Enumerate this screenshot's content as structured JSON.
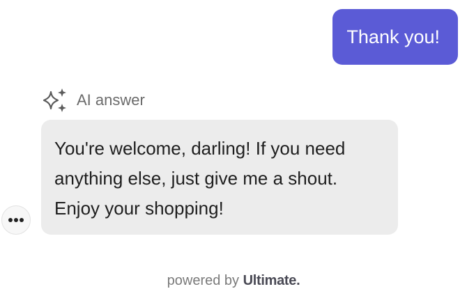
{
  "chat": {
    "user_message": "Thank you!",
    "ai_label": "AI answer",
    "ai_message": "You're welcome, darling! If you need anything else, just give me a shout. Enjoy your shopping!",
    "more_icon": "more-horizontal-icon",
    "ai_icon": "sparkles-icon"
  },
  "footer": {
    "powered_by": "powered by",
    "brand": "Ultimate."
  },
  "colors": {
    "user_bubble": "#5b5bd6",
    "ai_bubble": "#ececec",
    "background": "#ffffff"
  }
}
